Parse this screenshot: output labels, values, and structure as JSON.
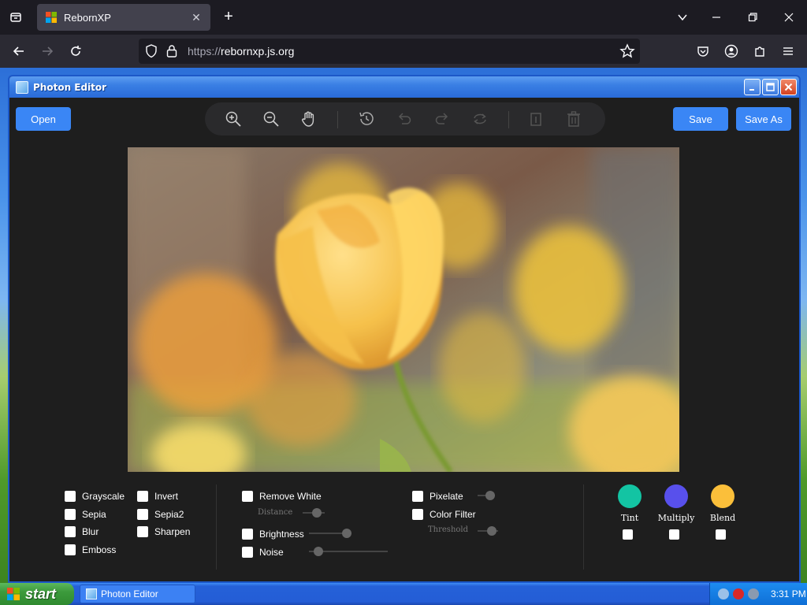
{
  "browser": {
    "tab_title": "RebornXP",
    "url_protocol": "https://",
    "url_host": "rebornxp.js.org",
    "theme_bg": "#1c1b22"
  },
  "window": {
    "title": "Photon Editor"
  },
  "buttons": {
    "open": "Open",
    "save": "Save",
    "save_as": "Save As"
  },
  "toolbar_icons": [
    "zoom-in-icon",
    "zoom-out-icon",
    "pan-hand-icon",
    "history-icon",
    "undo-icon",
    "redo-icon",
    "reset-icon",
    "crop-icon",
    "delete-icon"
  ],
  "filters": {
    "grayscale": "Grayscale",
    "invert": "Invert",
    "sepia": "Sepia",
    "sepia2": "Sepia2",
    "blur": "Blur",
    "sharpen": "Sharpen",
    "emboss": "Emboss",
    "remove_white": "Remove White",
    "distance": "Distance",
    "brightness": "Brightness",
    "noise": "Noise",
    "pixelate": "Pixelate",
    "color_filter": "Color Filter",
    "threshold": "Threshold"
  },
  "swatches": {
    "tint": {
      "label": "Tint",
      "color": "#13c4a3"
    },
    "multiply": {
      "label": "Multiply",
      "color": "#5850ec"
    },
    "blend": {
      "label": "Blend",
      "color": "#fbbf3a"
    }
  },
  "taskbar": {
    "start": "start",
    "task": "Photon Editor",
    "clock": "3:31 PM"
  }
}
